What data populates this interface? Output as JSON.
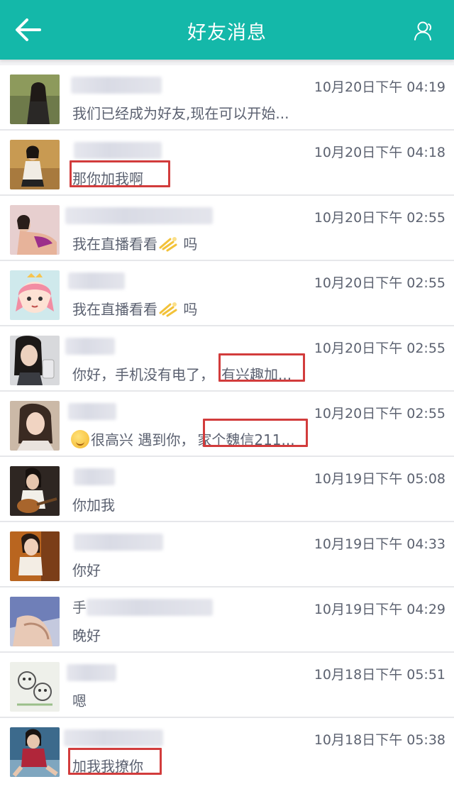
{
  "header": {
    "title": "好友消息",
    "back_icon": "back-arrow-icon",
    "profile_icon": "person-icon",
    "color": "#14b8a9"
  },
  "messages": [
    {
      "time": "10月20日下午 04:19",
      "text": "我们已经成为好友,现在可以开始...",
      "name": ""
    },
    {
      "time": "10月20日下午 04:18",
      "text": "那你加我啊",
      "name": ""
    },
    {
      "time": "10月20日下午 02:55",
      "text": "我在直播看看",
      "suffix": " 吗",
      "name": ""
    },
    {
      "time": "10月20日下午 02:55",
      "text": "我在直播看看",
      "suffix": " 吗",
      "name": ""
    },
    {
      "time": "10月20日下午 02:55",
      "text": "你好，手机没有电了，",
      "highlight": "有兴趣加...",
      "name": ""
    },
    {
      "time": "10月20日下午 02:55",
      "text": "很高兴 遇到你，",
      "highlight": "家个魏信211...",
      "name": ""
    },
    {
      "time": "10月19日下午 05:08",
      "text": "你加我",
      "name": ""
    },
    {
      "time": "10月19日下午 04:33",
      "text": "你好",
      "name": ""
    },
    {
      "time": "10月19日下午 04:29",
      "text": "晚好",
      "name": ""
    },
    {
      "time": "10月18日下午 05:51",
      "text": "嗯",
      "name": ""
    },
    {
      "time": "10月18日下午 05:38",
      "text": "加我我撩你",
      "name": ""
    }
  ],
  "highlight_color": "#d23c3c"
}
